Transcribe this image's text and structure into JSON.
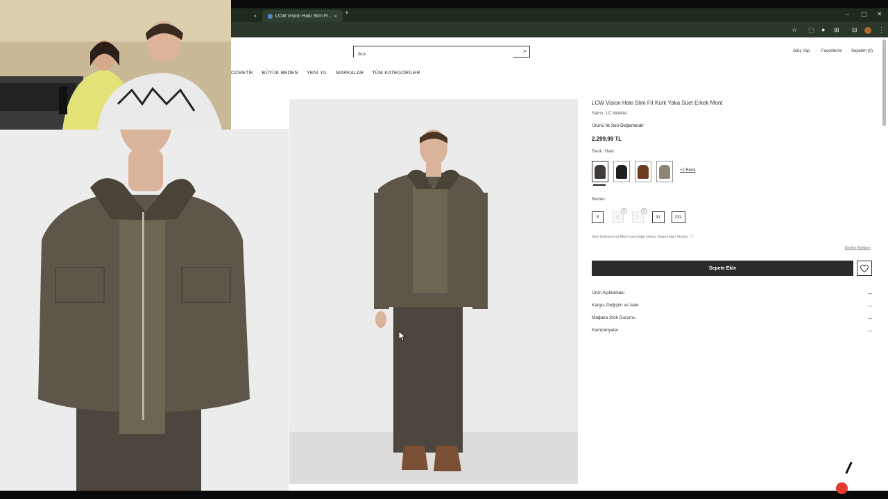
{
  "browser": {
    "inactive_tab_close": "×",
    "active_tab_title": "LCW Vision Haki Slim Fit Kürk Yaka Süet Erkek Mont",
    "active_tab_close": "×",
    "new_tab": "+",
    "window_controls": [
      "–",
      "▢",
      "✕"
    ],
    "toolbar_icons": [
      "☆",
      "⬚",
      "●",
      "⊞",
      "⊟",
      "⋮"
    ]
  },
  "header": {
    "search_placeholder": "Ara",
    "login": "Giriş Yap",
    "favorites": "Favorilerim",
    "cart": "Sepetim (0)"
  },
  "nav": {
    "items": [
      "OZMETİK",
      "BÜYÜK BEDEN",
      "YENİ YIL",
      "MARKALAR",
      "TÜM KATEGORİLER"
    ]
  },
  "product": {
    "title": "LCW Vision Haki Slim Fit Kürk Yaka Süet Erkek Mont",
    "seller": "Satıcı: LC Waikiki",
    "review_prompt": "Ürünü İlk Sen Değerlendir",
    "price": "2.299,99 TL",
    "color_label": "Renk: Haki",
    "swatches": [
      {
        "color": "#3f3d36",
        "selected": true
      },
      {
        "color": "#1f1f1f",
        "selected": false
      },
      {
        "color": "#6b3b22",
        "selected": false
      },
      {
        "color": "#8d8576",
        "selected": false
      }
    ],
    "more_colors": "+2 Renk",
    "size_label": "Beden:",
    "sizes": [
      {
        "label": "S",
        "available": true
      },
      {
        "label": "M",
        "available": false,
        "stock": "0"
      },
      {
        "label": "L",
        "available": false,
        "stock": "0"
      },
      {
        "label": "XL",
        "available": true
      },
      {
        "label": "2XL",
        "available": true
      }
    ],
    "fit_note": "Geri Gönünümü Mont uzunluğu Omuz hizasından ölçüsü. ⓘ",
    "size_guide": "Beden Rehberi",
    "add_to_cart": "Sepete Ekle",
    "accordion": [
      "Ürün Açıklaması",
      "Kargo, Değişim ve İade",
      "Mağaza Stok Durumu",
      "Kampanyalar"
    ],
    "accordion_arrow": "→"
  },
  "colors": {
    "jacket": "#5e5649",
    "sweater": "#6d6653",
    "pants": "#4c463f",
    "collar": "#4a4337",
    "skin": "#d9b49a",
    "hair": "#4a3527",
    "boots": "#7a4f33",
    "cta": "#2b2b2b",
    "tabbar": "#1d2a1d"
  }
}
